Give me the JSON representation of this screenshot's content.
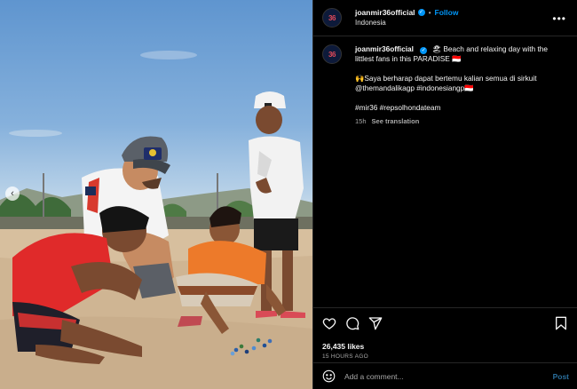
{
  "post": {
    "username": "joanmir36official",
    "follow_label": "Follow",
    "location": "Indonesia",
    "avatar_mark": "36",
    "more_label": "•••"
  },
  "caption": {
    "username": "joanmir36official",
    "line1": "🏖 Beach and relaxing day with the littlest fans in this PARADISE 🇮🇩",
    "line2": "🙌Saya berharap dapat bertemu kalian semua di sirkuit @themandalikagp #indonesiangp🇮🇩",
    "hashtags": "#mir36 #repsolhondateam",
    "time": "15h",
    "translation_label": "See translation"
  },
  "engagement": {
    "likes": "26,435 likes",
    "posted_ago": "15 HOURS AGO"
  },
  "comment_box": {
    "placeholder": "Add a comment...",
    "post_label": "Post"
  },
  "media": {
    "cap_logo_text": "Red Bull",
    "prev_label": "‹"
  },
  "icons": [
    "heart-icon",
    "comment-icon",
    "share-icon",
    "bookmark-icon",
    "emoji-icon",
    "verified-icon",
    "more-icon",
    "chevron-left-icon"
  ],
  "colors": {
    "accent": "#0095f6",
    "bg": "#000000",
    "border": "#262626",
    "muted": "#a8a8a8"
  }
}
